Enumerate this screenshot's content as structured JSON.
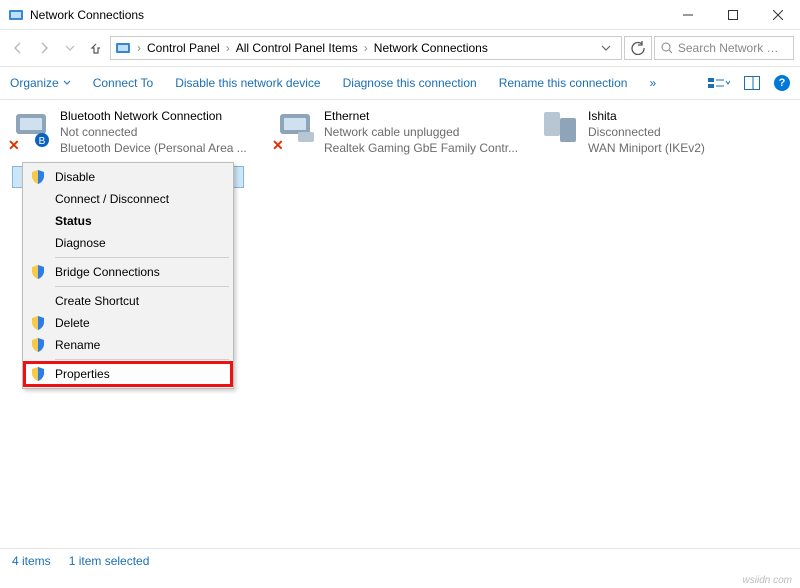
{
  "window": {
    "title": "Network Connections"
  },
  "breadcrumbs": {
    "b0": "Control Panel",
    "b1": "All Control Panel Items",
    "b2": "Network Connections"
  },
  "search": {
    "placeholder": "Search Network Con..."
  },
  "cmdbar": {
    "organize": "Organize",
    "connect": "Connect To",
    "disable": "Disable this network device",
    "diagnose": "Diagnose this connection",
    "rename": "Rename this connection",
    "more": "»"
  },
  "adapters": [
    {
      "name": "Bluetooth Network Connection",
      "status": "Not connected",
      "device": "Bluetooth Device (Personal Area ...",
      "err": true
    },
    {
      "name": "Ethernet",
      "status": "Network cable unplugged",
      "device": "Realtek Gaming GbE Family Contr...",
      "err": true
    },
    {
      "name": "Ishita",
      "status": "Disconnected",
      "device": "WAN Miniport (IKEv2)",
      "err": false
    }
  ],
  "ctx": {
    "disable": "Disable",
    "connect": "Connect / Disconnect",
    "status": "Status",
    "diagnose": "Diagnose",
    "bridge": "Bridge Connections",
    "shortcut": "Create Shortcut",
    "delete": "Delete",
    "rename": "Rename",
    "properties": "Properties"
  },
  "statusbar": {
    "count": "4 items",
    "selected": "1 item selected"
  },
  "watermark": "wsiidn com"
}
